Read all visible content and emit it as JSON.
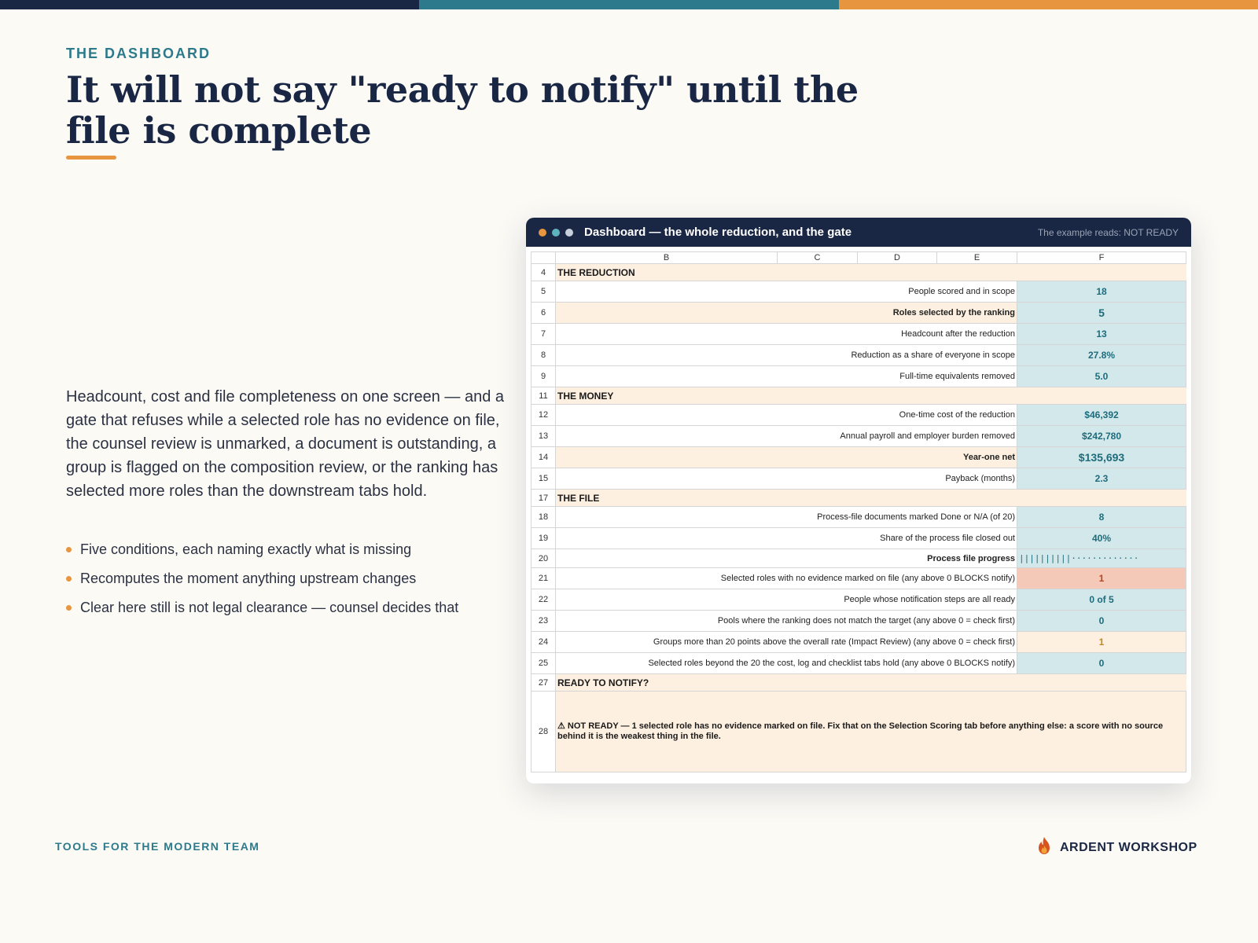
{
  "colors": {
    "navy": "#1a2744",
    "teal": "#2c7a8c",
    "orange": "#e8953f",
    "cell_teal": "#d3e8ea",
    "cell_peach": "#fdf0e0",
    "cell_red": "#f5c9b8"
  },
  "slide": {
    "eyebrow": "THE DASHBOARD",
    "headline": "It will not say \"ready to notify\" until the file is complete",
    "body": "Headcount, cost and file completeness on one screen — and a gate that refuses while a selected role has no evidence on file, the counsel review is unmarked, a document is outstanding, a group is flagged on the composition review, or the ranking has selected more roles than the downstream tabs hold.",
    "bullets": [
      "Five conditions, each naming exactly what is missing",
      "Recomputes the moment anything upstream changes",
      "Clear here still is not legal clearance — counsel decides that"
    ]
  },
  "footer": {
    "tagline": "TOOLS FOR THE MODERN TEAM",
    "brand": "ARDENT WORKSHOP",
    "logo_icon": "flame-icon"
  },
  "window": {
    "title": "Dashboard — the whole reduction, and the gate",
    "status": "The example reads: NOT READY",
    "columns": [
      "B",
      "C",
      "D",
      "E",
      "F"
    ]
  },
  "sheet": {
    "section_reduction": {
      "num": "4",
      "label": "THE REDUCTION"
    },
    "r5": {
      "num": "5",
      "label": "People scored and in scope",
      "value": "18"
    },
    "r6": {
      "num": "6",
      "label": "Roles selected by the ranking",
      "value": "5"
    },
    "r7": {
      "num": "7",
      "label": "Headcount after the reduction",
      "value": "13"
    },
    "r8": {
      "num": "8",
      "label": "Reduction as a share of everyone in scope",
      "value": "27.8%"
    },
    "r9": {
      "num": "9",
      "label": "Full-time equivalents removed",
      "value": "5.0"
    },
    "section_money": {
      "num": "11",
      "label": "THE MONEY"
    },
    "r12": {
      "num": "12",
      "label": "One-time cost of the reduction",
      "value": "$46,392"
    },
    "r13": {
      "num": "13",
      "label": "Annual payroll and employer burden removed",
      "value": "$242,780"
    },
    "r14": {
      "num": "14",
      "label": "Year-one net",
      "value": "$135,693"
    },
    "r15": {
      "num": "15",
      "label": "Payback (months)",
      "value": "2.3"
    },
    "section_file": {
      "num": "17",
      "label": "THE FILE"
    },
    "r18": {
      "num": "18",
      "label": "Process-file documents marked Done or N/A (of 20)",
      "value": "8"
    },
    "r19": {
      "num": "19",
      "label": "Share of the process file closed out",
      "value": "40%"
    },
    "r20": {
      "num": "20",
      "label": "Process file progress",
      "value": "||||||||||·············",
      "progress_fraction": 0.4
    },
    "r21": {
      "num": "21",
      "label": "Selected roles with no evidence marked on file  (any above 0 BLOCKS notify)",
      "value": "1"
    },
    "r22": {
      "num": "22",
      "label": "People whose notification steps are all ready",
      "value": "0 of 5"
    },
    "r23": {
      "num": "23",
      "label": "Pools where the ranking does not match the target  (any above 0 = check first)",
      "value": "0"
    },
    "r24": {
      "num": "24",
      "label": "Groups more than 20 points above the overall rate (Impact Review)  (any above 0 = check first)",
      "value": "1"
    },
    "r25": {
      "num": "25",
      "label": "Selected roles beyond the 20 the cost, log and checklist tabs hold  (any above 0 BLOCKS notify)",
      "value": "0"
    },
    "section_ready": {
      "num": "27",
      "label": "READY TO NOTIFY?"
    },
    "r28": {
      "num": "28",
      "text": "⚠  NOT READY — 1 selected role has no evidence marked on file. Fix that on the Selection Scoring tab before anything else: a score with no source behind it is the weakest thing in the file."
    }
  }
}
